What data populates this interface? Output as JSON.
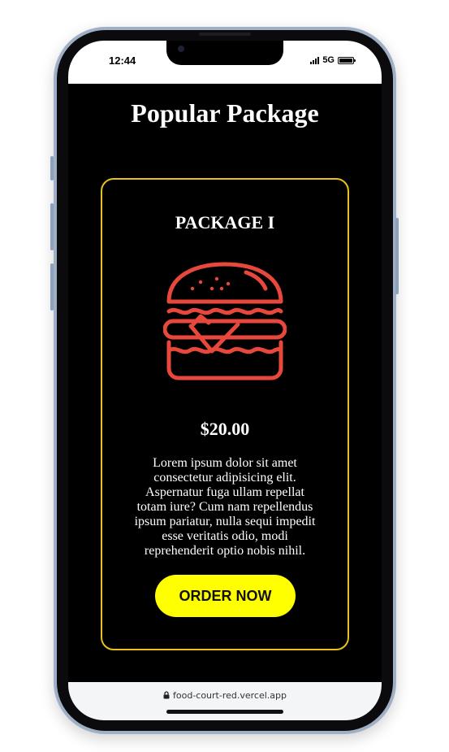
{
  "status_bar": {
    "time": "12:44",
    "network": "5G",
    "icons": [
      "signal-icon",
      "battery-icon"
    ]
  },
  "page": {
    "title": "Popular Package"
  },
  "package": {
    "name": "PACKAGE I",
    "icon": "burger-icon",
    "icon_color": "#e8473b",
    "price": "$20.00",
    "description": "Lorem ipsum dolor sit amet consectetur adipisicing elit. Aspernatur fuga ullam repellat totam iure? Cum nam repellendus ipsum pariatur, nulla sequi impedit esse veritatis odio, modi reprehenderit optio nobis nihil.",
    "button_label": "ORDER NOW",
    "border_color": "#e8c21b",
    "button_color": "#ffff00"
  },
  "browser": {
    "url": "food-court-red.vercel.app",
    "icon": "lock-icon"
  }
}
